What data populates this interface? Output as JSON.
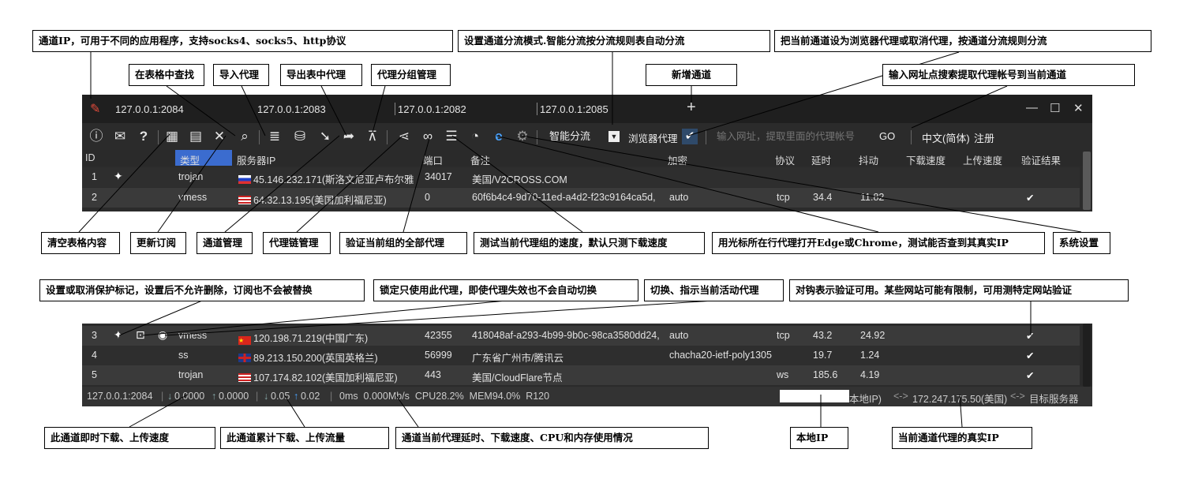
{
  "tabs": [
    "127.0.0.1:2084",
    "127.0.0.1:2083",
    "127.0.0.1:2082",
    "127.0.0.1:2085"
  ],
  "add_tab": "+",
  "win_controls": {
    "min": "—",
    "max": "☐",
    "close": "✕"
  },
  "toolbar": {
    "icons": [
      "info-icon",
      "mail-icon",
      "help-icon",
      "table-search-icon",
      "import-icon",
      "clear-icon",
      "find-icon",
      "database-import-icon",
      "database-export-icon",
      "download-arrow-icon",
      "share-arrow-icon",
      "group-tree-icon",
      "share-icon",
      "link-chain-icon",
      "list-check-icon",
      "speed-icon",
      "edge-icon",
      "gear-icon"
    ],
    "mode": "智能分流",
    "browser_proxy": "浏览器代理",
    "url_placeholder": "输入网址，提取里面的代理帐号",
    "go": "GO",
    "language": "中文(简体)",
    "register": "注册"
  },
  "columns": [
    "ID",
    "类型",
    "服务器IP",
    "端口",
    "备注",
    "加密",
    "协议",
    "延时",
    "抖动",
    "下载速度",
    "上传速度",
    "验证结果"
  ],
  "rows_top": [
    {
      "id": "1",
      "pin": "📌",
      "type": "trojan",
      "flag": "si",
      "server": "45.146.232.171(斯洛文尼亚卢布尔雅",
      "port": "34017",
      "note": "美国/V2CROSS.COM",
      "enc": "",
      "proto": "",
      "delay": "",
      "jitter": "",
      "down": "",
      "up": "",
      "ok": ""
    },
    {
      "id": "2",
      "pin": "",
      "type": "vmess",
      "flag": "us",
      "server": "64.32.13.195(美国加利福尼亚)",
      "port": "0",
      "note": "60f6b4c4-9d70-11ed-a4d2-f23c9164ca5d,",
      "enc": "auto",
      "proto": "tcp",
      "delay": "34.4",
      "jitter": "11.82",
      "down": "",
      "up": "",
      "ok": "✔"
    }
  ],
  "rows_bot": [
    {
      "id": "3",
      "pin": "📌",
      "type": "vmess",
      "flag": "cn",
      "server": "120.198.71.219(中国广东)",
      "port": "42355",
      "note": "418048af-a293-4b99-9b0c-98ca3580dd24,",
      "enc": "auto",
      "proto": "tcp",
      "delay": "43.2",
      "jitter": "24.92",
      "down": "",
      "up": "",
      "ok": "✔"
    },
    {
      "id": "4",
      "pin": "",
      "type": "ss",
      "flag": "gb",
      "server": "89.213.150.200(英国英格兰)",
      "port": "56999",
      "note": "广东省广州市/腾讯云",
      "enc": "chacha20-ietf-poly1305",
      "proto": "",
      "delay": "19.7",
      "jitter": "1.24",
      "down": "",
      "up": "",
      "ok": "✔"
    },
    {
      "id": "5",
      "pin": "",
      "type": "trojan",
      "flag": "us",
      "server": "107.174.82.102(美国加利福尼亚)",
      "port": "443",
      "note": "美国/CloudFlare节点",
      "enc": "",
      "proto": "ws",
      "delay": "185.6",
      "jitter": "4.19",
      "down": "",
      "up": "",
      "ok": "✔"
    }
  ],
  "status": {
    "channel": "127.0.0.1:2084",
    "down_now": "0.0000",
    "up_now": "0.0000",
    "down_total": "0.05",
    "up_total": "0.02",
    "perf": "0ms  0.000Mb/s  CPU28.2%  MEM94.0%  R120",
    "local_ip": "本地IP)",
    "proxy_ip": "172.247.175.50(美国)",
    "target": "目标服务器",
    "arrow": "<->"
  },
  "callouts": {
    "channel_ip": "通道IP，可用于不同的应用程序，支持socks4、socks5、http协议",
    "split_mode": "设置通道分流模式.智能分流按分流规则表自动分流",
    "browser_proxy": "把当前通道设为浏览器代理或取消代理，按通道分流规则分流",
    "find": "在表格中查找",
    "import": "导入代理",
    "export": "导出表中代理",
    "group": "代理分组管理",
    "new_channel": "新增通道",
    "url_extract": "输入网址点搜索提取代理帐号到当前通道",
    "clear": "清空表格内容",
    "update_sub": "更新订阅",
    "channel_mgmt": "通道管理",
    "chain_mgmt": "代理链管理",
    "verify_all": "验证当前组的全部代理",
    "test_speed": "测试当前代理组的速度，默认只测下载速度",
    "open_browser": "用光标所在行代理打开Edge或Chrome，测试能否查到其真实IP",
    "settings": "系统设置",
    "protect": "设置或取消保护标记，设置后不允许删除，订阅也不会被替换",
    "lock": "锁定只使用此代理，即使代理失效也不会自动切换",
    "switch": "切换、指示当前活动代理",
    "verified": "对钩表示验证可用。某些网站可能有限制，可用测特定网站验证",
    "instant_speed": "此通道即时下载、上传速度",
    "total_traffic": "此通道累计下载、上传流量",
    "perf_info": "通道当前代理延时、下载速度、CPU和内存使用情况",
    "local_ip": "本地IP",
    "real_ip": "当前通道代理的真实IP"
  },
  "colors": {
    "panel": "#2b2b2b",
    "selected_header": "#3b6ccf",
    "accent_blue": "#4aa3ff",
    "red": "#e34b3c"
  }
}
